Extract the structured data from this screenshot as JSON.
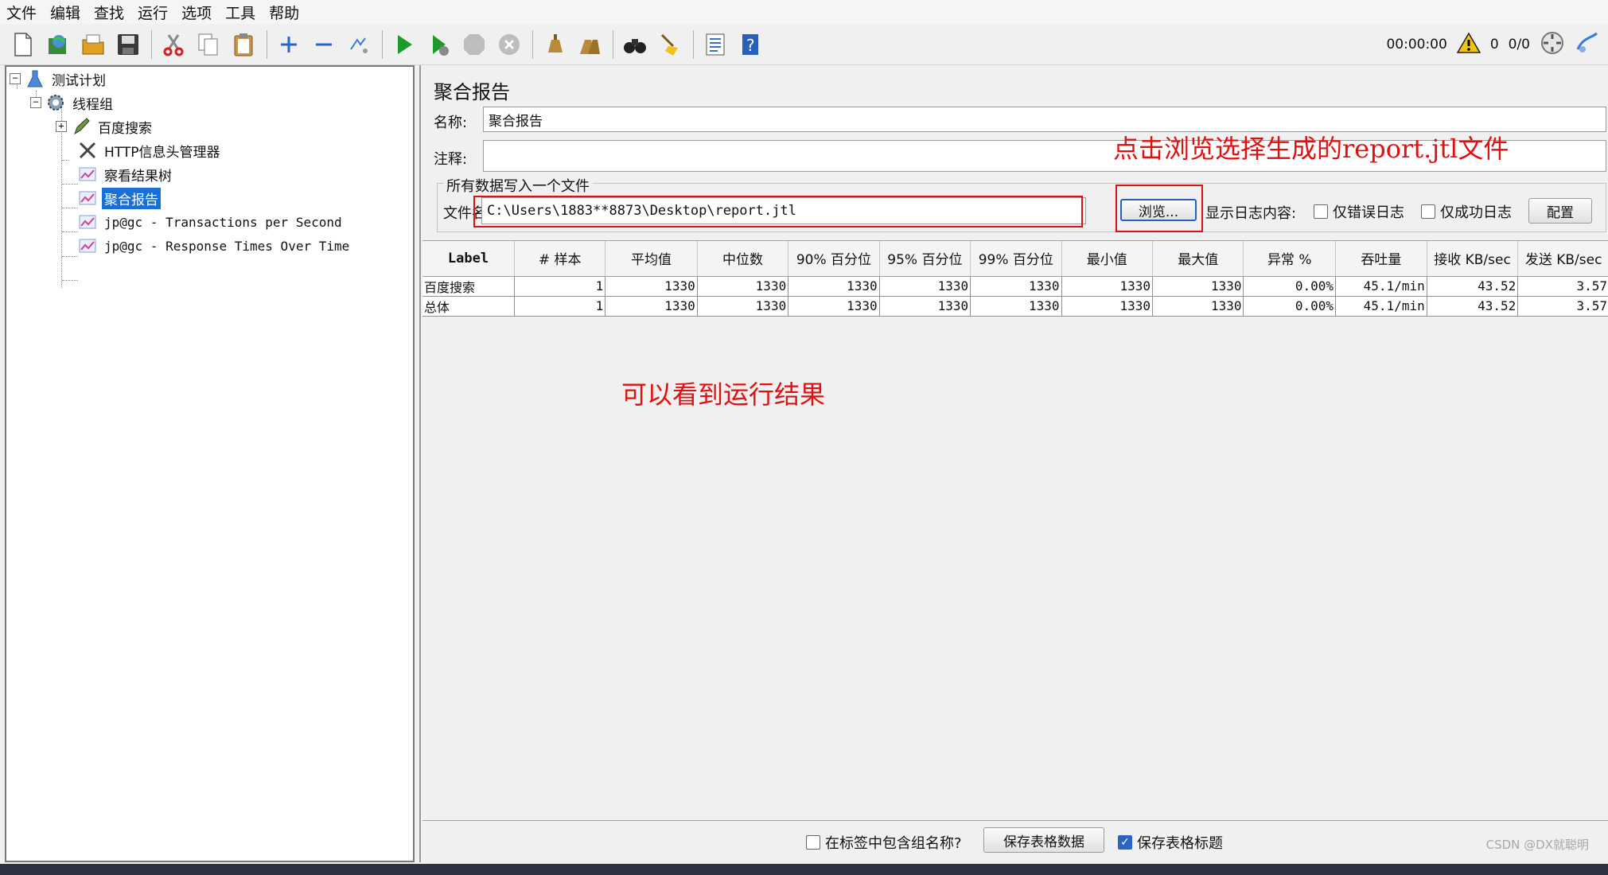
{
  "menu": [
    "文件",
    "编辑",
    "查找",
    "运行",
    "选项",
    "工具",
    "帮助"
  ],
  "toolbar": {
    "timer": "00:00:00",
    "warning_count": "0",
    "threads": "0/0"
  },
  "tree": {
    "items": [
      {
        "label": "测试计划",
        "icon": "test-plan-icon"
      },
      {
        "label": "线程组",
        "icon": "thread-group-gear-icon"
      },
      {
        "label": "百度搜索",
        "icon": "http-sampler-pen-icon"
      },
      {
        "label": "HTTP信息头管理器",
        "icon": "config-tools-icon"
      },
      {
        "label": "察看结果树",
        "icon": "listener-chart-icon"
      },
      {
        "label": "聚合报告",
        "icon": "listener-chart-icon"
      },
      {
        "label": "jp@gc - Transactions per Second",
        "icon": "listener-chart-icon"
      },
      {
        "label": "jp@gc - Response Times Over Time",
        "icon": "listener-chart-icon"
      }
    ]
  },
  "panel": {
    "title": "聚合报告",
    "name_label": "名称:",
    "name_value": "聚合报告",
    "comment_label": "注释:",
    "comment_value": "",
    "group_title": "所有数据写入一个文件",
    "file_label": "文件名",
    "file_value": "C:\\Users\\1883**8873\\Desktop\\report.jtl",
    "browse_button": "浏览...",
    "log_label": "显示日志内容:",
    "errors_only": "仅错误日志",
    "success_only": "仅成功日志",
    "config_button": "配置"
  },
  "table": {
    "headers": [
      "Label",
      "# 样本",
      "平均值",
      "中位数",
      "90% 百分位",
      "95% 百分位",
      "99% 百分位",
      "最小值",
      "最大值",
      "异常 %",
      "吞吐量",
      "接收 KB/sec",
      "发送 KB/sec"
    ],
    "rows": [
      [
        "百度搜索",
        "1",
        "1330",
        "1330",
        "1330",
        "1330",
        "1330",
        "1330",
        "1330",
        "0.00%",
        "45.1/min",
        "43.52",
        "3.57"
      ],
      [
        "总体",
        "1",
        "1330",
        "1330",
        "1330",
        "1330",
        "1330",
        "1330",
        "1330",
        "0.00%",
        "45.1/min",
        "43.52",
        "3.57"
      ]
    ]
  },
  "bottom": {
    "include_group": "在标签中包含组名称?",
    "save_table": "保存表格数据",
    "save_header": "保存表格标题",
    "save_header_checked": true
  },
  "annotations": {
    "browse_hint": "点击浏览选择生成的report.jtl文件",
    "result_hint": "可以看到运行结果"
  },
  "watermark": "CSDN @DX就聪明",
  "colors": {
    "selection": "#1a6fd6",
    "annotation": "#e01010",
    "run_green": "#1c9a2a"
  }
}
